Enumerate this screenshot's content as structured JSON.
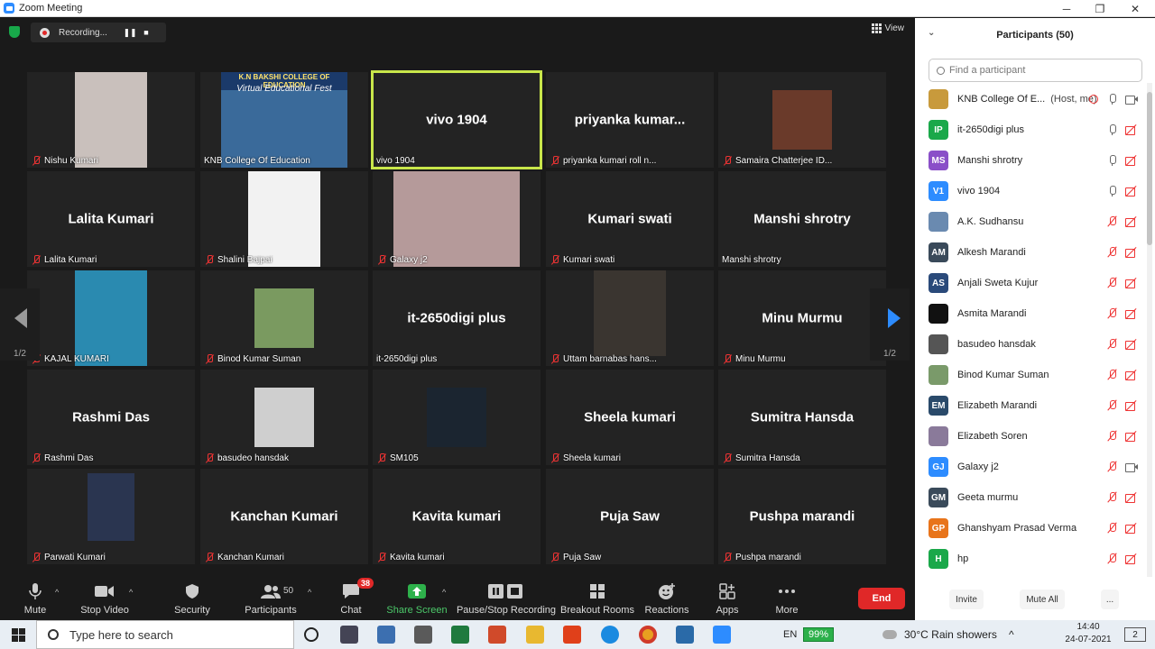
{
  "window": {
    "title": "Zoom Meeting",
    "minimize": "─",
    "maximize": "❐",
    "close": "✕"
  },
  "recording": {
    "label": "Recording...",
    "pause": "❚❚",
    "stop": "■"
  },
  "view": {
    "label": "View"
  },
  "pager": {
    "left": "1/2",
    "right": "1/2"
  },
  "tiles": [
    {
      "name": "Nishu Kumari",
      "big": "",
      "muted": true
    },
    {
      "name": "KNB College Of Education",
      "big": "",
      "muted": false
    },
    {
      "name": "vivo 1904",
      "big": "vivo 1904",
      "muted": false
    },
    {
      "name": "priyanka kumari roll n...",
      "big": "priyanka  kumar...",
      "muted": true
    },
    {
      "name": "Samaira Chatterjee ID...",
      "big": "",
      "muted": true
    },
    {
      "name": "Lalita Kumari",
      "big": "Lalita Kumari",
      "muted": true
    },
    {
      "name": "Shalini Bajpai",
      "big": "",
      "muted": true
    },
    {
      "name": "Galaxy j2",
      "big": "",
      "muted": true
    },
    {
      "name": "Kumari swati",
      "big": "Kumari swati",
      "muted": true
    },
    {
      "name": "Manshi shrotry",
      "big": "Manshi shrotry",
      "muted": false
    },
    {
      "name": "KAJAL KUMARI",
      "big": "",
      "muted": true
    },
    {
      "name": "Binod Kumar Suman",
      "big": "",
      "muted": true
    },
    {
      "name": "it-2650digi plus",
      "big": "it-2650digi plus",
      "muted": false
    },
    {
      "name": "Uttam barnabas hans...",
      "big": "",
      "muted": true
    },
    {
      "name": "Minu Murmu",
      "big": "Minu Murmu",
      "muted": true
    },
    {
      "name": "Rashmi Das",
      "big": "Rashmi Das",
      "muted": true
    },
    {
      "name": "basudeo hansdak",
      "big": "",
      "muted": true
    },
    {
      "name": "SM105",
      "big": "",
      "muted": true
    },
    {
      "name": "Sheela kumari",
      "big": "Sheela kumari",
      "muted": true
    },
    {
      "name": "Sumitra Hansda",
      "big": "Sumitra Hansda",
      "muted": true
    },
    {
      "name": "Parwati Kumari",
      "big": "",
      "muted": true
    },
    {
      "name": "Kanchan Kumari",
      "big": "Kanchan Kumari",
      "muted": true
    },
    {
      "name": "Kavita kumari",
      "big": "Kavita kumari",
      "muted": true
    },
    {
      "name": "Puja Saw",
      "big": "Puja Saw",
      "muted": true
    },
    {
      "name": "Pushpa marandi",
      "big": "Pushpa marandi",
      "muted": true
    }
  ],
  "banner": {
    "college": "K.N BAKSHI COLLEGE OF EDUCATION",
    "fest": "Virtual Educational Fest"
  },
  "toolbar": {
    "mute": "Mute",
    "stop_video": "Stop Video",
    "security": "Security",
    "participants": "Participants",
    "participants_count": "50",
    "chat": "Chat",
    "chat_badge": "38",
    "share": "Share Screen",
    "record": "Pause/Stop Recording",
    "breakout": "Breakout Rooms",
    "reactions": "Reactions",
    "apps": "Apps",
    "more": "More",
    "end": "End",
    "caret": "^"
  },
  "panel": {
    "title": "Participants (50)",
    "search_placeholder": "Find a participant",
    "invite": "Invite",
    "mute_all": "Mute All",
    "more": "...",
    "participants": [
      {
        "initials": "",
        "name": "KNB College Of E...",
        "host": "(Host, me)",
        "color": "#c89a3c",
        "mic": "on",
        "cam": "on"
      },
      {
        "initials": "IP",
        "name": "it-2650digi plus",
        "host": "",
        "color": "#1aa84a",
        "mic": "on",
        "cam": "off"
      },
      {
        "initials": "MS",
        "name": "Manshi shrotry",
        "host": "",
        "color": "#8a4fc8",
        "mic": "on",
        "cam": "off"
      },
      {
        "initials": "V1",
        "name": "vivo 1904",
        "host": "",
        "color": "#2d8cff",
        "mic": "on",
        "cam": "off"
      },
      {
        "initials": "",
        "name": "A.K. Sudhansu",
        "host": "",
        "color": "#6a8ab0",
        "mic": "off",
        "cam": "off"
      },
      {
        "initials": "AM",
        "name": "Alkesh Marandi",
        "host": "",
        "color": "#3a4a5a",
        "mic": "off",
        "cam": "off"
      },
      {
        "initials": "AS",
        "name": "Anjali Sweta Kujur",
        "host": "",
        "color": "#2a4a7a",
        "mic": "off",
        "cam": "off"
      },
      {
        "initials": "",
        "name": "Asmita Marandi",
        "host": "",
        "color": "#111111",
        "mic": "off",
        "cam": "off"
      },
      {
        "initials": "",
        "name": "basudeo hansdak",
        "host": "",
        "color": "#555555",
        "mic": "off",
        "cam": "off"
      },
      {
        "initials": "",
        "name": "Binod Kumar Suman",
        "host": "",
        "color": "#7a9a6a",
        "mic": "off",
        "cam": "off"
      },
      {
        "initials": "EM",
        "name": "Elizabeth Marandi",
        "host": "",
        "color": "#2a4a6a",
        "mic": "off",
        "cam": "off"
      },
      {
        "initials": "",
        "name": "Elizabeth Soren",
        "host": "",
        "color": "#8a7a9a",
        "mic": "off",
        "cam": "off"
      },
      {
        "initials": "GJ",
        "name": "Galaxy j2",
        "host": "",
        "color": "#2d8cff",
        "mic": "off",
        "cam": "on"
      },
      {
        "initials": "GM",
        "name": "Geeta murmu",
        "host": "",
        "color": "#3a4a5a",
        "mic": "off",
        "cam": "off"
      },
      {
        "initials": "GP",
        "name": "Ghanshyam Prasad Verma",
        "host": "",
        "color": "#e8741a",
        "mic": "off",
        "cam": "off"
      },
      {
        "initials": "H",
        "name": "hp",
        "host": "",
        "color": "#1aa84a",
        "mic": "off",
        "cam": "off"
      }
    ]
  },
  "taskbar": {
    "search_placeholder": "Type here to search",
    "language": "EN",
    "battery": "99%",
    "weather": "30°C  Rain showers",
    "time": "14:40",
    "date": "24-07-2021",
    "notifications": "2"
  }
}
